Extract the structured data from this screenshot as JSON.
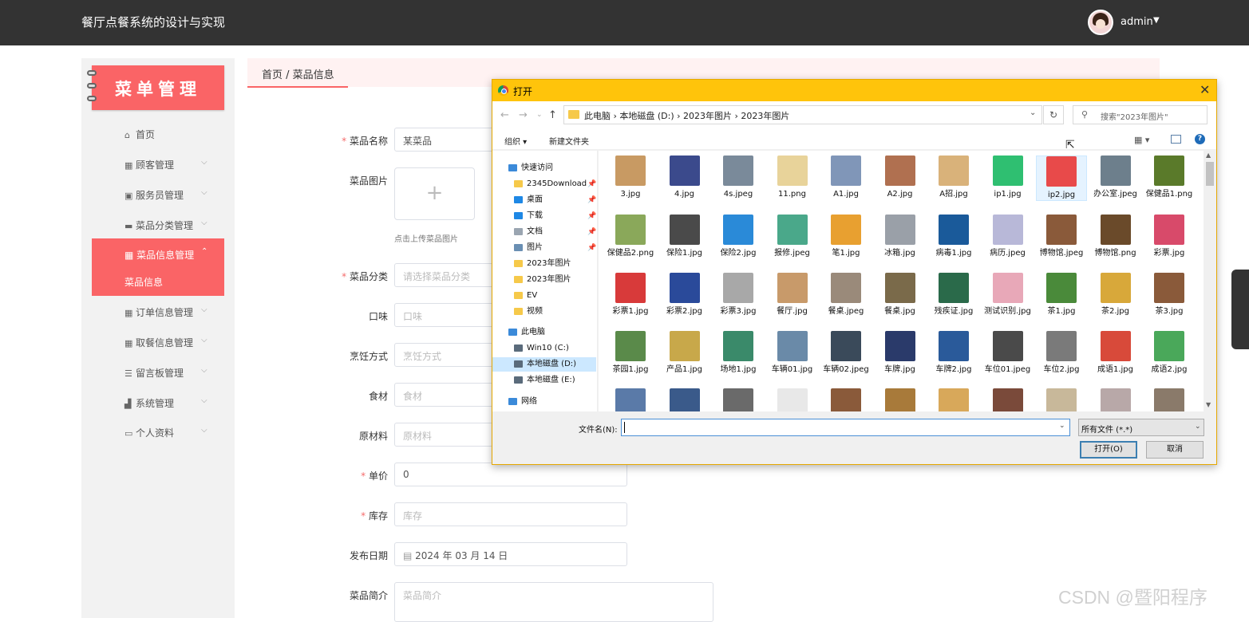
{
  "header": {
    "title": "餐厅点餐系统的设计与实现",
    "user": "admin",
    "caret": "▼"
  },
  "sidebar": {
    "logo": "菜单管理",
    "items": [
      {
        "label": "首页",
        "icon": "⌂",
        "chev": ""
      },
      {
        "label": "顾客管理",
        "icon": "▦",
        "chev": "⌵"
      },
      {
        "label": "服务员管理",
        "icon": "▣",
        "chev": "⌵"
      },
      {
        "label": "菜品分类管理",
        "icon": "▬",
        "chev": "⌵"
      },
      {
        "label": "订单信息管理",
        "icon": "▦",
        "chev": "⌵"
      },
      {
        "label": "取餐信息管理",
        "icon": "▦",
        "chev": "⌵"
      },
      {
        "label": "留言板管理",
        "icon": "☰",
        "chev": "⌵"
      },
      {
        "label": "系统管理",
        "icon": "▟",
        "chev": "⌵"
      },
      {
        "label": "个人资料",
        "icon": "▭",
        "chev": "⌵"
      }
    ],
    "active": {
      "label": "菜品信息管理",
      "icon": "▦",
      "chev": "⌃",
      "sub": "菜品信息"
    }
  },
  "breadcrumb": "首页 / 菜品信息",
  "form": {
    "fields": [
      {
        "label": "菜品名称",
        "required": "*",
        "value": "某菜品",
        "placeholder": ""
      },
      {
        "label": "菜品图片",
        "required": "",
        "upload_plus": "+",
        "upload_tip": "点击上传菜品图片"
      },
      {
        "label": "菜品分类",
        "required": "*",
        "value": "",
        "placeholder": "请选择菜品分类"
      },
      {
        "label": "口味",
        "required": "",
        "value": "",
        "placeholder": "口味"
      },
      {
        "label": "烹饪方式",
        "required": "",
        "value": "",
        "placeholder": "烹饪方式"
      },
      {
        "label": "食材",
        "required": "",
        "value": "",
        "placeholder": "食材"
      },
      {
        "label": "原材料",
        "required": "",
        "value": "",
        "placeholder": "原材料"
      },
      {
        "label": "单价",
        "required": "*",
        "value": "0",
        "placeholder": ""
      },
      {
        "label": "库存",
        "required": "*",
        "value": "",
        "placeholder": "库存"
      },
      {
        "label": "发布日期",
        "required": "",
        "value": "2024 年 03 月 14 日",
        "placeholder": ""
      },
      {
        "label": "菜品简介",
        "required": "",
        "value": "",
        "placeholder": "菜品简介"
      }
    ]
  },
  "dialog": {
    "title": "打开",
    "close": "✕",
    "address": "此电脑 › 本地磁盘 (D:) › 2023年图片 › 2023年图片",
    "search_placeholder": "搜索\"2023年图片\"",
    "toolbar": {
      "organize": "组织 ▾",
      "new_folder": "新建文件夹"
    },
    "tree": [
      {
        "label": "快速访问",
        "icon": "star",
        "color": "#3b8ad9",
        "pin": ""
      },
      {
        "label": "2345Download",
        "icon": "folder",
        "color": "#f6c94a",
        "pin": "📌"
      },
      {
        "label": "桌面",
        "icon": "desktop",
        "color": "#1e88e5",
        "pin": "📌"
      },
      {
        "label": "下载",
        "icon": "download",
        "color": "#1e88e5",
        "pin": "📌"
      },
      {
        "label": "文档",
        "icon": "doc",
        "color": "#9aa5b1",
        "pin": "📌"
      },
      {
        "label": "图片",
        "icon": "picture",
        "color": "#6a8fb3",
        "pin": "📌"
      },
      {
        "label": "2023年图片",
        "icon": "folder",
        "color": "#f6c94a",
        "pin": ""
      },
      {
        "label": "2023年图片",
        "icon": "folder",
        "color": "#f6c94a",
        "pin": ""
      },
      {
        "label": "EV",
        "icon": "folder",
        "color": "#f6c94a",
        "pin": ""
      },
      {
        "label": "视频",
        "icon": "folder",
        "color": "#f6c94a",
        "pin": ""
      },
      {
        "label": "此电脑",
        "icon": "pc",
        "color": "#3b8ad9",
        "pin": ""
      },
      {
        "label": "Win10 (C:)",
        "icon": "drive",
        "color": "#5a6b7b",
        "pin": ""
      },
      {
        "label": "本地磁盘 (D:)",
        "icon": "drive",
        "color": "#5a6b7b",
        "pin": ""
      },
      {
        "label": "本地磁盘 (E:)",
        "icon": "drive",
        "color": "#5a6b7b",
        "pin": ""
      },
      {
        "label": "网络",
        "icon": "network",
        "color": "#3b8ad9",
        "pin": ""
      }
    ],
    "files": [
      {
        "name": "3.jpg",
        "color": "#c89a63"
      },
      {
        "name": "4.jpg",
        "color": "#3b4a8c"
      },
      {
        "name": "4s.jpeg",
        "color": "#7a8a9a"
      },
      {
        "name": "11.png",
        "color": "#e8d39a"
      },
      {
        "name": "A1.jpg",
        "color": "#8096b8"
      },
      {
        "name": "A2.jpg",
        "color": "#b07050"
      },
      {
        "name": "A招.jpg",
        "color": "#d9b27a"
      },
      {
        "name": "ip1.jpg",
        "color": "#2fbf71"
      },
      {
        "name": "ip2.jpg",
        "color": "#e84a4a"
      },
      {
        "name": "办公室.jpeg",
        "color": "#6d7f8c"
      },
      {
        "name": "保健品1.png",
        "color": "#5a7a2a"
      },
      {
        "name": "保健品2.png",
        "color": "#8aa85a"
      },
      {
        "name": "保险1.jpg",
        "color": "#4a4a4a"
      },
      {
        "name": "保险2.jpg",
        "color": "#2a8ad8"
      },
      {
        "name": "报修.jpeg",
        "color": "#4aa88a"
      },
      {
        "name": "笔1.jpg",
        "color": "#e8a030"
      },
      {
        "name": "冰箱.jpg",
        "color": "#9aa0a8"
      },
      {
        "name": "病毒1.jpg",
        "color": "#1a5a9a"
      },
      {
        "name": "病历.jpeg",
        "color": "#b8b8d8"
      },
      {
        "name": "博物馆.jpeg",
        "color": "#8a5a3a"
      },
      {
        "name": "博物馆.png",
        "color": "#6a4a2a"
      },
      {
        "name": "彩票.jpg",
        "color": "#d84a6a"
      },
      {
        "name": "彩票1.jpg",
        "color": "#d83a3a"
      },
      {
        "name": "彩票2.jpg",
        "color": "#2a4a9a"
      },
      {
        "name": "彩票3.jpg",
        "color": "#a8a8a8"
      },
      {
        "name": "餐厅.jpg",
        "color": "#c89a6a"
      },
      {
        "name": "餐桌.jpeg",
        "color": "#9a8a7a"
      },
      {
        "name": "餐桌.jpg",
        "color": "#7a6a4a"
      },
      {
        "name": "残疾证.jpg",
        "color": "#2a6a4a"
      },
      {
        "name": "测试识别.jpg",
        "color": "#e8a8b8"
      },
      {
        "name": "茶1.jpg",
        "color": "#4a8a3a"
      },
      {
        "name": "茶2.jpg",
        "color": "#d8a83a"
      },
      {
        "name": "茶3.jpg",
        "color": "#8a5a3a"
      },
      {
        "name": "茶园1.jpg",
        "color": "#5a8a4a"
      },
      {
        "name": "产品1.jpg",
        "color": "#c8a84a"
      },
      {
        "name": "场地1.jpg",
        "color": "#3a8a6a"
      },
      {
        "name": "车辆01.jpg",
        "color": "#6a8aa8"
      },
      {
        "name": "车辆02.jpeg",
        "color": "#3a4a5a"
      },
      {
        "name": "车牌.jpg",
        "color": "#2a3a6a"
      },
      {
        "name": "车牌2.jpg",
        "color": "#2a5a9a"
      },
      {
        "name": "车位01.jpeg",
        "color": "#4a4a4a"
      },
      {
        "name": "车位2.jpg",
        "color": "#7a7a7a"
      },
      {
        "name": "成语1.jpg",
        "color": "#d84a3a"
      },
      {
        "name": "成语2.jpg",
        "color": "#4aa85a"
      },
      {
        "name": "",
        "color": "#5a7aa8"
      },
      {
        "name": "",
        "color": "#3a5a8a"
      },
      {
        "name": "",
        "color": "#6a6a6a"
      },
      {
        "name": "",
        "color": "#e8e8e8"
      },
      {
        "name": "",
        "color": "#8a5a3a"
      },
      {
        "name": "",
        "color": "#a87a3a"
      },
      {
        "name": "",
        "color": "#d8a85a"
      },
      {
        "name": "",
        "color": "#7a4a3a"
      },
      {
        "name": "",
        "color": "#c8b89a"
      },
      {
        "name": "",
        "color": "#b8a8a8"
      },
      {
        "name": "",
        "color": "#8a7a6a"
      }
    ],
    "filename_label": "文件名(N):",
    "filename_value": "",
    "filetype": "所有文件 (*.*)",
    "open_button": "打开(O)",
    "cancel_button": "取消"
  },
  "watermark": "CSDN @暨阳程序",
  "colors": {
    "accent": "#fa6466",
    "topbar": "#333333",
    "dialog_title": "#ffc40b"
  }
}
